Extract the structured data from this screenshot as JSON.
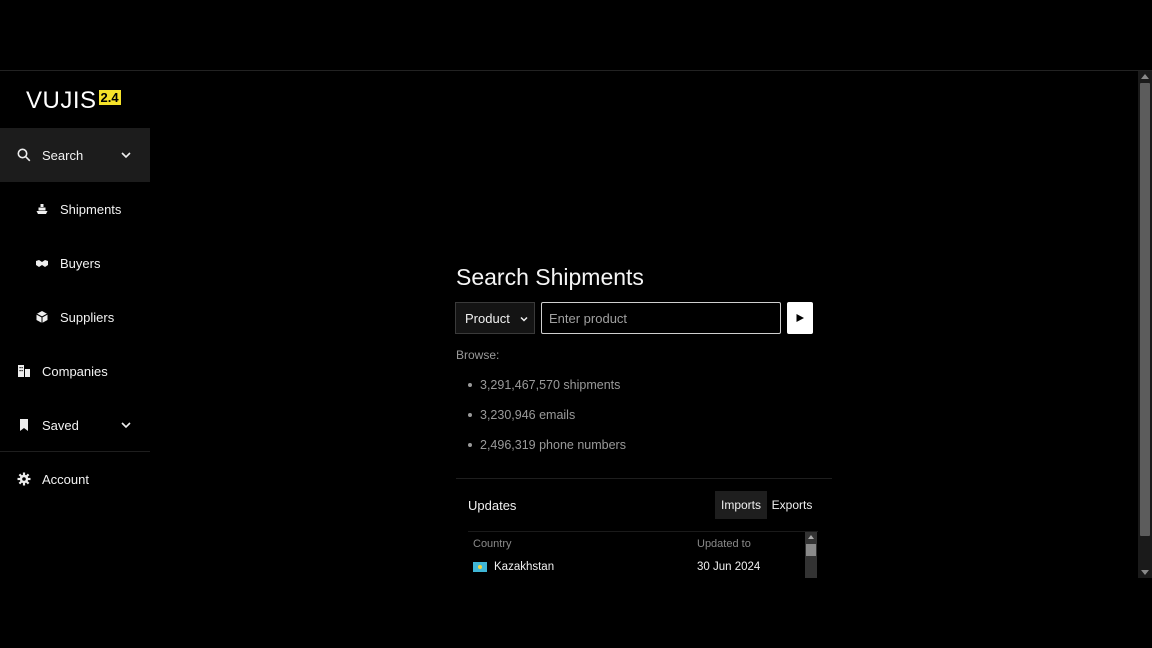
{
  "app": {
    "logo_text": "VUJIS",
    "version": "2.4",
    "accent_color": "#f5e22a"
  },
  "sidebar": {
    "items": [
      {
        "label": "Search",
        "icon": "search-icon",
        "active": true,
        "expandable": true
      },
      {
        "label": "Shipments",
        "icon": "ship-icon",
        "sub": true
      },
      {
        "label": "Buyers",
        "icon": "handshake-icon",
        "sub": true
      },
      {
        "label": "Suppliers",
        "icon": "box-icon",
        "sub": true
      },
      {
        "label": "Companies",
        "icon": "buildings-icon"
      },
      {
        "label": "Saved",
        "icon": "bookmark-icon",
        "expandable": true
      },
      {
        "label": "Account",
        "icon": "gear-icon"
      }
    ]
  },
  "search": {
    "title": "Search Shipments",
    "type_select": "Product",
    "placeholder": "Enter product",
    "submit_icon": "play-icon"
  },
  "browse": {
    "label": "Browse:",
    "items": [
      "3,291,467,570 shipments",
      "3,230,946 emails",
      "2,496,319 phone numbers"
    ]
  },
  "updates": {
    "title": "Updates",
    "tabs": [
      {
        "label": "Imports",
        "active": true
      },
      {
        "label": "Exports",
        "active": false
      }
    ],
    "columns": [
      "Country",
      "Updated to"
    ],
    "rows": [
      {
        "country": "Kazakhstan",
        "updated_to": "30 Jun 2024"
      }
    ]
  }
}
